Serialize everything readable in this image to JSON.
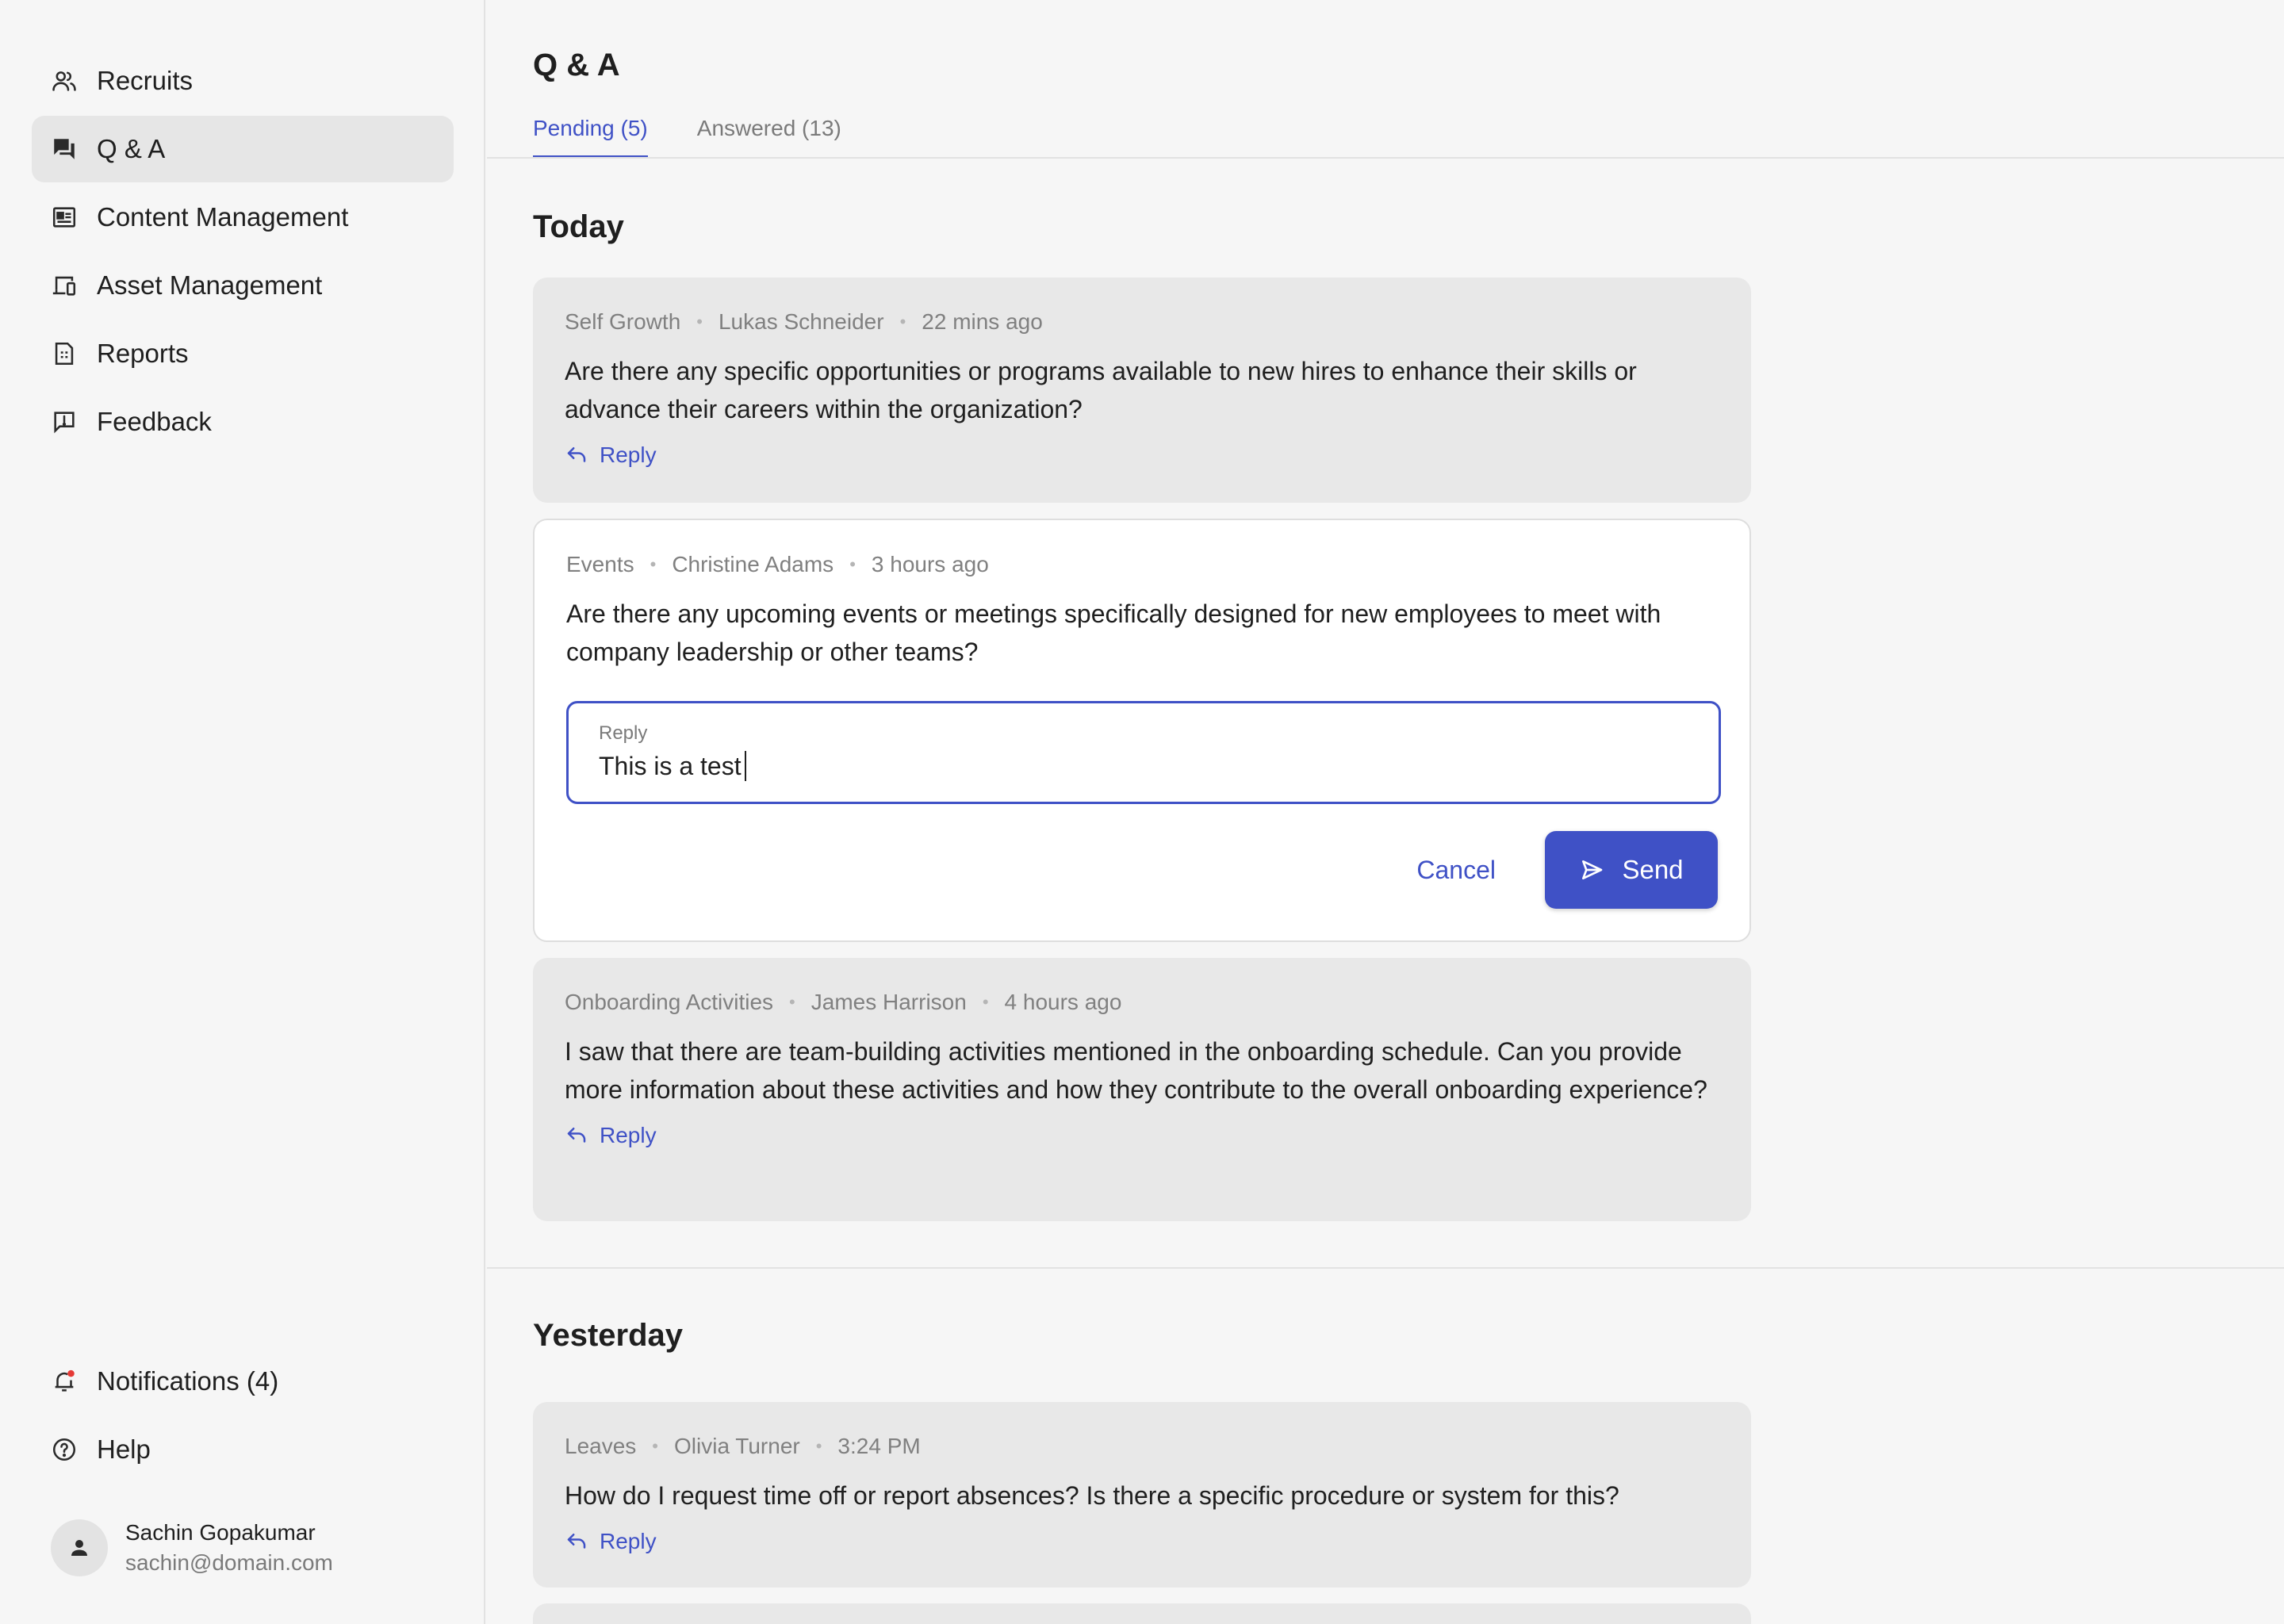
{
  "sidebar": {
    "items": [
      {
        "label": "Recruits",
        "icon": "users-icon"
      },
      {
        "label": "Q & A",
        "icon": "chat-icon"
      },
      {
        "label": "Content Management",
        "icon": "newspaper-icon"
      },
      {
        "label": "Asset Management",
        "icon": "devices-icon"
      },
      {
        "label": "Reports",
        "icon": "report-icon"
      },
      {
        "label": "Feedback",
        "icon": "feedback-icon"
      }
    ],
    "bottom": [
      {
        "label": "Notifications (4)",
        "icon": "bell-icon"
      },
      {
        "label": "Help",
        "icon": "help-icon"
      }
    ],
    "profile": {
      "name": "Sachin Gopakumar",
      "email": "sachin@domain.com"
    }
  },
  "main": {
    "title": "Q & A",
    "tabs": [
      {
        "label": "Pending (5)",
        "active": true
      },
      {
        "label": "Answered (13)",
        "active": false
      }
    ],
    "sections": [
      {
        "title": "Today",
        "cards": [
          {
            "category": "Self Growth",
            "author": "Lukas Schneider",
            "time": "22 mins ago",
            "question": "Are there any specific opportunities or programs available to new hires to enhance their skills or advance their careers within the organization?",
            "reply_label": "Reply"
          },
          {
            "category": "Events",
            "author": "Christine Adams",
            "time": "3 hours ago",
            "question": "Are there any upcoming events or meetings specifically designed for new employees to meet with company leadership or other teams?",
            "reply_field_label": "Reply",
            "reply_value": "This is a test",
            "cancel_label": "Cancel",
            "send_label": "Send"
          },
          {
            "category": "Onboarding Activities",
            "author": "James Harrison",
            "time": "4 hours ago",
            "question": "I saw that there are team-building activities mentioned in the onboarding schedule. Can you provide more information about these activities and how they contribute to the overall onboarding experience?",
            "reply_label": "Reply"
          }
        ]
      },
      {
        "title": "Yesterday",
        "cards": [
          {
            "category": "Leaves",
            "author": "Olivia Turner",
            "time": "3:24 PM",
            "question": "How do I request time off or report absences? Is there a specific procedure or system for this?",
            "reply_label": "Reply"
          }
        ]
      }
    ]
  },
  "colors": {
    "accent": "#3f51c6",
    "card_bg": "#e8e8e8",
    "page_bg": "#f6f6f6",
    "notification_dot": "#e53935"
  }
}
